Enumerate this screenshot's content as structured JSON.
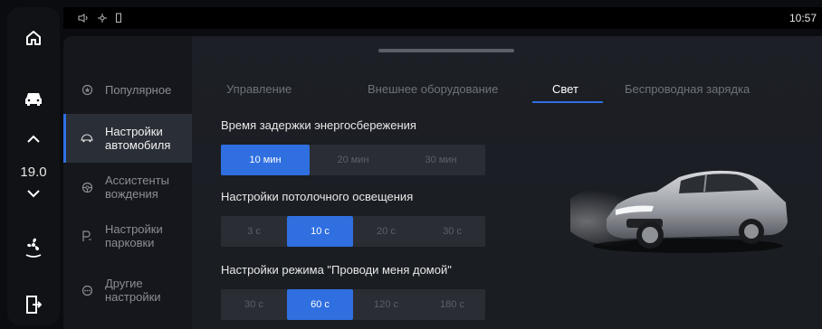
{
  "status": {
    "time": "10:57",
    "icons": [
      "volume-icon",
      "bluetooth-icon",
      "battery-icon"
    ]
  },
  "dock": {
    "temperature": "19.0",
    "items": [
      "home-icon",
      "car-icon",
      "chevron-up-icon",
      "chevron-down-icon",
      "fan-icon",
      "exit-icon"
    ]
  },
  "sidebar": {
    "items": [
      {
        "label": "Популярное",
        "icon": "star-icon",
        "active": false
      },
      {
        "label": "Настройки\nавтомобиля",
        "icon": "car-outline-icon",
        "active": true
      },
      {
        "label": "Ассистенты\nвождения",
        "icon": "steering-icon",
        "active": false
      },
      {
        "label": "Настройки\nпарковки",
        "icon": "parking-icon",
        "active": false
      },
      {
        "label": "Другие\nнастройки",
        "icon": "more-icon",
        "active": false
      }
    ]
  },
  "tabs": [
    {
      "label": "Управление",
      "active": false
    },
    {
      "label": "Внешнее оборудование",
      "active": false
    },
    {
      "label": "Свет",
      "active": true
    },
    {
      "label": "Беспроводная зарядка",
      "active": false
    }
  ],
  "sections": {
    "energy": {
      "title": "Время задержки энергосбережения",
      "options": [
        "10 мин",
        "20 мин",
        "30 мин"
      ],
      "selected": "10 мин"
    },
    "ceiling": {
      "title": "Настройки потолочного освещения",
      "options": [
        "3 с",
        "10 с",
        "20 с",
        "30 с"
      ],
      "selected": "10 с"
    },
    "home": {
      "title": "Настройки режима \"Проводи меня домой\"",
      "options": [
        "30 с",
        "60 с",
        "120 с",
        "180 с"
      ],
      "selected": "60 с"
    }
  },
  "colors": {
    "accent": "#2f6fe0",
    "panel": "#1c1f25",
    "segment": "#2a2d33"
  }
}
